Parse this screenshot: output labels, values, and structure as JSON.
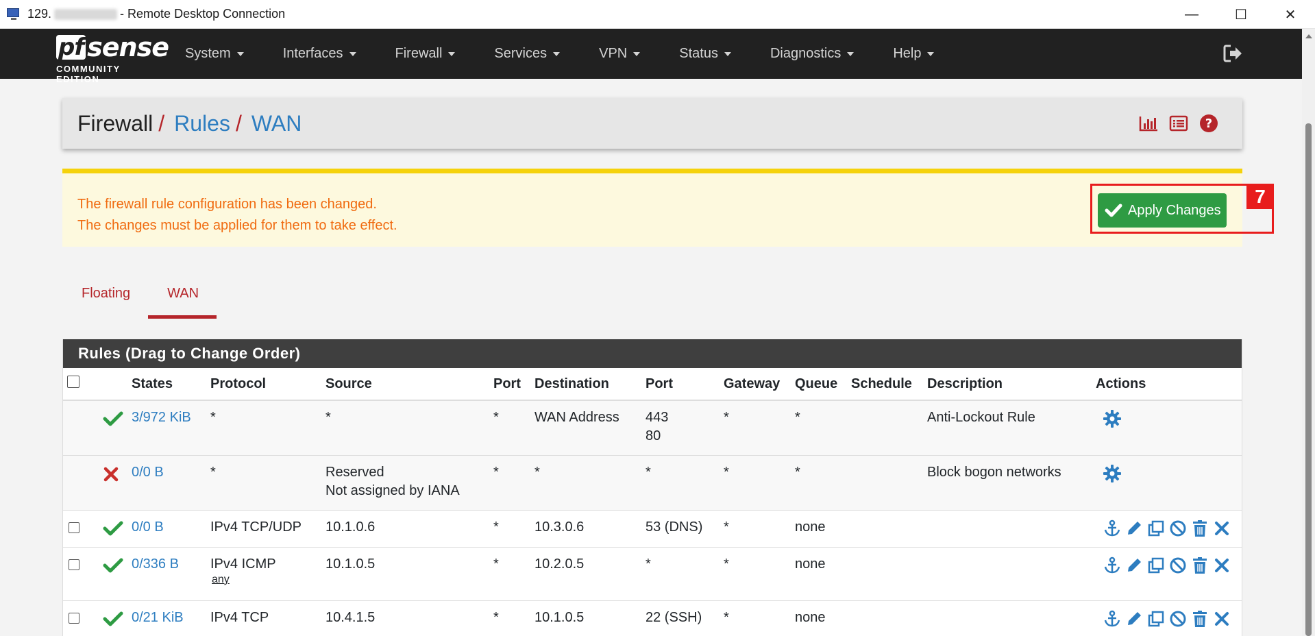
{
  "rdp": {
    "title_prefix": "129.",
    "title_suffix": "- Remote Desktop Connection",
    "minimize": "—",
    "maximize": "☐",
    "close": "✕"
  },
  "logo": {
    "pf": "pf",
    "sense": "sense",
    "edition": "COMMUNITY EDITION"
  },
  "nav": {
    "items": [
      "System",
      "Interfaces",
      "Firewall",
      "Services",
      "VPN",
      "Status",
      "Diagnostics",
      "Help"
    ]
  },
  "breadcrumb": {
    "home": "Firewall",
    "sep1": "/",
    "rules": "Rules",
    "sep2": "/",
    "current": "WAN"
  },
  "alert": {
    "line1": "The firewall rule configuration has been changed.",
    "line2": "The changes must be applied for them to take effect.",
    "apply_label": "Apply Changes"
  },
  "annotation": {
    "number": "7"
  },
  "tabs": [
    {
      "label": "Floating",
      "active": false
    },
    {
      "label": "WAN",
      "active": true
    }
  ],
  "rules": {
    "panel_title": "Rules (Drag to Change Order)",
    "columns": [
      "States",
      "Protocol",
      "Source",
      "Port",
      "Destination",
      "Port",
      "Gateway",
      "Queue",
      "Schedule",
      "Description",
      "Actions"
    ],
    "rows": [
      {
        "status": "pass",
        "states": "3/972 KiB",
        "protocol": "*",
        "protocol_sub": "",
        "source": "*",
        "source2": "",
        "sport": "*",
        "destination": "WAN Address",
        "dport": "443",
        "dport2": "80",
        "gateway": "*",
        "queue": "*",
        "schedule": "",
        "description": "Anti-Lockout Rule",
        "fixed": true
      },
      {
        "status": "block",
        "states": "0/0 B",
        "protocol": "*",
        "protocol_sub": "",
        "source": "Reserved",
        "source2": "Not assigned by IANA",
        "sport": "*",
        "destination": "*",
        "dport": "*",
        "dport2": "",
        "gateway": "*",
        "queue": "*",
        "schedule": "",
        "description": "Block bogon networks",
        "fixed": true
      },
      {
        "status": "pass",
        "states": "0/0 B",
        "protocol": "IPv4 TCP/UDP",
        "protocol_sub": "",
        "source": "10.1.0.6",
        "source2": "",
        "sport": "*",
        "destination": "10.3.0.6",
        "dport": "53 (DNS)",
        "dport2": "",
        "gateway": "*",
        "queue": "none",
        "schedule": "",
        "description": "",
        "fixed": false
      },
      {
        "status": "pass",
        "states": "0/336 B",
        "protocol": "IPv4 ICMP",
        "protocol_sub": "any",
        "source": "10.1.0.5",
        "source2": "",
        "sport": "*",
        "destination": "10.2.0.5",
        "dport": "*",
        "dport2": "",
        "gateway": "*",
        "queue": "none",
        "schedule": "",
        "description": "",
        "fixed": false
      },
      {
        "status": "pass",
        "states": "0/21 KiB",
        "protocol": "IPv4 TCP",
        "protocol_sub": "",
        "source": "10.4.1.5",
        "source2": "",
        "sport": "*",
        "destination": "10.1.0.5",
        "dport": "22 (SSH)",
        "dport2": "",
        "gateway": "*",
        "queue": "none",
        "schedule": "",
        "description": "",
        "fixed": false
      }
    ]
  },
  "colors": {
    "navbar": "#212121",
    "accent_red": "#b5252a",
    "link_blue": "#2d7dc0",
    "pass_green": "#2e9b43",
    "block_red": "#c9302c",
    "alert_text": "#f06b10",
    "alert_border": "#f5d20b"
  }
}
